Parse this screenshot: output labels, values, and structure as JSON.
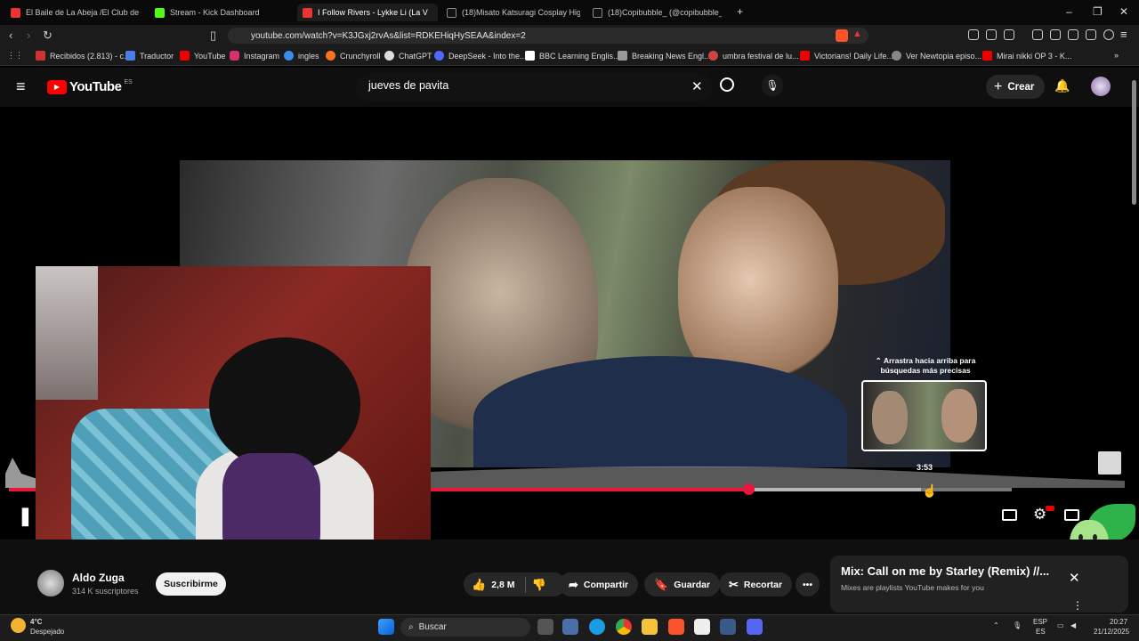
{
  "colors": {
    "accent": "#e8163b",
    "youtube_red": "#ff0000",
    "background": "#0f0f0f"
  },
  "tabs": [
    {
      "label": "El Baile de La Abeja /El Club de Kids",
      "icon": "youtube-icon",
      "active": false
    },
    {
      "label": "Stream - Kick Dashboard",
      "icon": "kick-icon",
      "active": false
    },
    {
      "label": "I Follow Rivers - Lykke Li (La V",
      "icon": "youtube-icon",
      "active": true
    },
    {
      "label": "(18)Misato Katsuragi Cosplay Highlights",
      "icon": "tiktok-icon",
      "active": false
    },
    {
      "label": "(18)Copibubble_ (@copibubble_)",
      "icon": "tiktok-icon",
      "active": false
    }
  ],
  "address": {
    "url": "youtube.com/watch?v=K3JGxj2rvAs&list=RDKEHiqHySEAA&index=2"
  },
  "bookmarks": [
    {
      "label": "Recibidos (2.813) - c...",
      "icon": "gmail-icon"
    },
    {
      "label": "Traductor",
      "icon": "translate-icon"
    },
    {
      "label": "YouTube",
      "icon": "youtube-icon"
    },
    {
      "label": "Instagram",
      "icon": "instagram-icon"
    },
    {
      "label": "ingles",
      "icon": "cloud-icon"
    },
    {
      "label": "Crunchyroll",
      "icon": "crunchyroll-icon"
    },
    {
      "label": "ChatGPT",
      "icon": "chatgpt-icon"
    },
    {
      "label": "DeepSeek - Into the...",
      "icon": "deepseek-icon"
    },
    {
      "label": "BBC Learning Englis...",
      "icon": "bbc-icon"
    },
    {
      "label": "Breaking News Engl...",
      "icon": "news-icon"
    },
    {
      "label": "umbra festival de lu...",
      "icon": "globe-icon"
    },
    {
      "label": "Victorians! Daily Life...",
      "icon": "youtube-icon"
    },
    {
      "label": "Ver Newtopia episo...",
      "icon": "globe-icon"
    },
    {
      "label": "Mirai nikki OP 3 - K...",
      "icon": "youtube-icon"
    }
  ],
  "youtube": {
    "logo": "YouTube",
    "region": "ES",
    "search_value": "jueves de pavita",
    "create_label": "Crear"
  },
  "player": {
    "drag_hint": "⌃ Arrastra hacia arriba para búsquedas más precisas",
    "hover_time": "3:53",
    "progress_fraction": 0.665,
    "buffer_fraction": 0.82
  },
  "video_info": {
    "channel": "Aldo Zuga",
    "subscribers": "314 K suscriptores",
    "subscribe_label": "Suscribirme",
    "likes": "2,8 M",
    "share_label": "Compartir",
    "save_label": "Guardar",
    "clip_label": "Recortar"
  },
  "mix": {
    "title": "Mix: Call on me by Starley (Remix) //...",
    "subtitle": "Mixes are playlists YouTube makes for you"
  },
  "taskbar": {
    "weather_temp": "4°C",
    "weather_desc": "Despejado",
    "search_label": "Buscar",
    "lang_top": "ESP",
    "lang_bottom": "ES",
    "time": "20:27",
    "date": "21/12/2025"
  }
}
